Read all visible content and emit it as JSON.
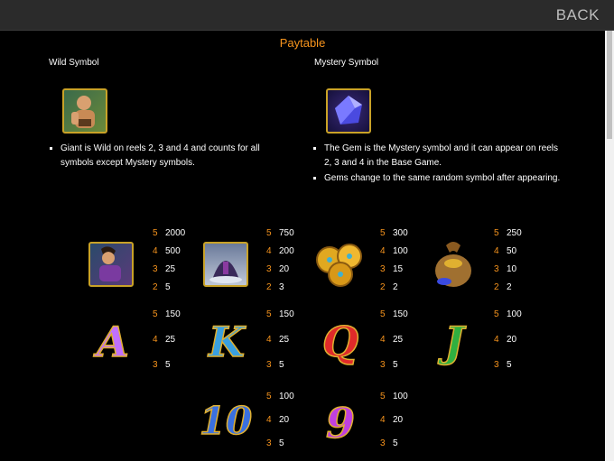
{
  "header": {
    "back_label": "BACK"
  },
  "paytable": {
    "title": "Paytable",
    "wild": {
      "title": "Wild Symbol",
      "icon": "giant-wild-icon",
      "bullets": [
        "Giant is Wild on reels 2, 3 and 4 and counts for all symbols except Mystery symbols."
      ]
    },
    "mystery": {
      "title": "Mystery Symbol",
      "icon": "gem-mystery-icon",
      "bullets": [
        "The Gem is the Mystery symbol and it can appear on reels 2, 3 and 4 in the Base Game.",
        "Gems change to the same random symbol after appearing."
      ]
    },
    "symbols": [
      {
        "icon": "hero-symbol-icon",
        "pays": [
          {
            "n": "5",
            "v": "2000"
          },
          {
            "n": "4",
            "v": "500"
          },
          {
            "n": "3",
            "v": "25"
          },
          {
            "n": "2",
            "v": "5"
          }
        ]
      },
      {
        "icon": "castle-symbol-icon",
        "pays": [
          {
            "n": "5",
            "v": "750"
          },
          {
            "n": "4",
            "v": "200"
          },
          {
            "n": "3",
            "v": "20"
          },
          {
            "n": "2",
            "v": "3"
          }
        ]
      },
      {
        "icon": "gold-coins-symbol-icon",
        "pays": [
          {
            "n": "5",
            "v": "300"
          },
          {
            "n": "4",
            "v": "100"
          },
          {
            "n": "3",
            "v": "15"
          },
          {
            "n": "2",
            "v": "2"
          }
        ]
      },
      {
        "icon": "treasure-bag-symbol-icon",
        "pays": [
          {
            "n": "5",
            "v": "250"
          },
          {
            "n": "4",
            "v": "50"
          },
          {
            "n": "3",
            "v": "10"
          },
          {
            "n": "2",
            "v": "2"
          }
        ]
      },
      {
        "icon": "letter-a-symbol-icon",
        "glyph": "A",
        "pays": [
          {
            "n": "5",
            "v": "150"
          },
          {
            "n": "4",
            "v": "25"
          },
          {
            "n": "3",
            "v": "5"
          }
        ]
      },
      {
        "icon": "letter-k-symbol-icon",
        "glyph": "K",
        "pays": [
          {
            "n": "5",
            "v": "150"
          },
          {
            "n": "4",
            "v": "25"
          },
          {
            "n": "3",
            "v": "5"
          }
        ]
      },
      {
        "icon": "letter-q-symbol-icon",
        "glyph": "Q",
        "pays": [
          {
            "n": "5",
            "v": "150"
          },
          {
            "n": "4",
            "v": "25"
          },
          {
            "n": "3",
            "v": "5"
          }
        ]
      },
      {
        "icon": "letter-j-symbol-icon",
        "glyph": "J",
        "pays": [
          {
            "n": "5",
            "v": "100"
          },
          {
            "n": "4",
            "v": "20"
          },
          {
            "n": "3",
            "v": "5"
          }
        ]
      },
      {
        "icon": "number-10-symbol-icon",
        "glyph": "10",
        "pays": [
          {
            "n": "5",
            "v": "100"
          },
          {
            "n": "4",
            "v": "20"
          },
          {
            "n": "3",
            "v": "5"
          }
        ]
      },
      {
        "icon": "number-9-symbol-icon",
        "glyph": "9",
        "pays": [
          {
            "n": "5",
            "v": "100"
          },
          {
            "n": "4",
            "v": "20"
          },
          {
            "n": "3",
            "v": "5"
          }
        ]
      }
    ]
  },
  "colors": {
    "accent": "#f7941d",
    "background": "#000000",
    "header_bg": "#2b2b2b",
    "frame_gold": "#c9a227"
  }
}
